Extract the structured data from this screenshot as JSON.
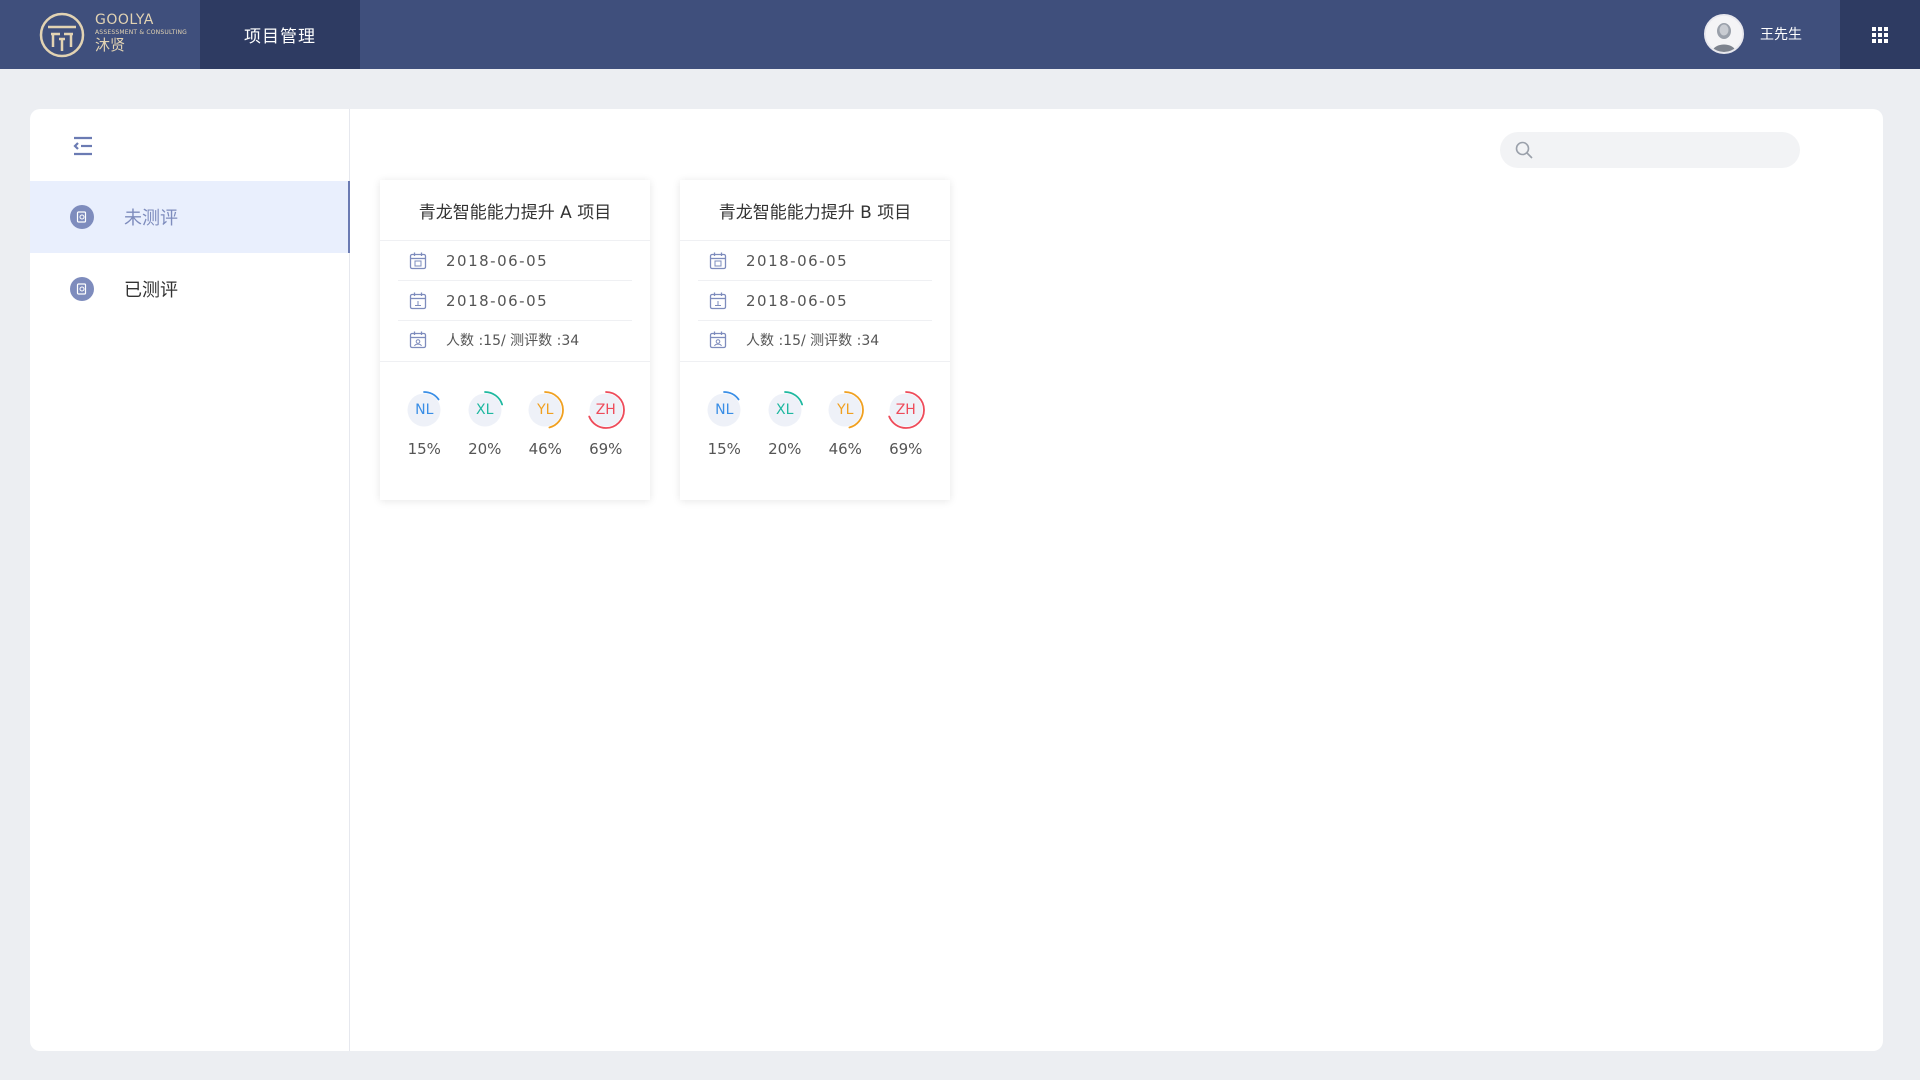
{
  "header": {
    "logo_en": "GOOLYA",
    "logo_sub": "ASSESSMENT & CONSULTING",
    "logo_cn": "沐贤",
    "nav_active": "项目管理",
    "user_name": "王先生"
  },
  "sidebar": {
    "items": [
      {
        "label": "未测评",
        "active": true
      },
      {
        "label": "已测评",
        "active": false
      }
    ]
  },
  "search": {
    "placeholder": "",
    "value": ""
  },
  "colors": {
    "nav": "#3f4f7c",
    "nav_dark": "#2e3b62",
    "NL": "#3a8ee6",
    "XL": "#1fb8a0",
    "YL": "#f0a020",
    "ZH": "#ee4b5a"
  },
  "cards": [
    {
      "title": "青龙智能能力提升 A 项目",
      "start_date": "2018-06-05",
      "end_date": "2018-06-05",
      "counts": "人数 :15/ 测评数 :34",
      "metrics": [
        {
          "code": "NL",
          "pct": "15%",
          "value": 0.15,
          "color": "#3a8ee6"
        },
        {
          "code": "XL",
          "pct": "20%",
          "value": 0.2,
          "color": "#1fb8a0"
        },
        {
          "code": "YL",
          "pct": "46%",
          "value": 0.46,
          "color": "#f0a020"
        },
        {
          "code": "ZH",
          "pct": "69%",
          "value": 0.69,
          "color": "#ee4b5a"
        }
      ]
    },
    {
      "title": "青龙智能能力提升 B 项目",
      "start_date": "2018-06-05",
      "end_date": "2018-06-05",
      "counts": "人数 :15/ 测评数 :34",
      "metrics": [
        {
          "code": "NL",
          "pct": "15%",
          "value": 0.15,
          "color": "#3a8ee6"
        },
        {
          "code": "XL",
          "pct": "20%",
          "value": 0.2,
          "color": "#1fb8a0"
        },
        {
          "code": "YL",
          "pct": "46%",
          "value": 0.46,
          "color": "#f0a020"
        },
        {
          "code": "ZH",
          "pct": "69%",
          "value": 0.69,
          "color": "#ee4b5a"
        }
      ]
    }
  ]
}
